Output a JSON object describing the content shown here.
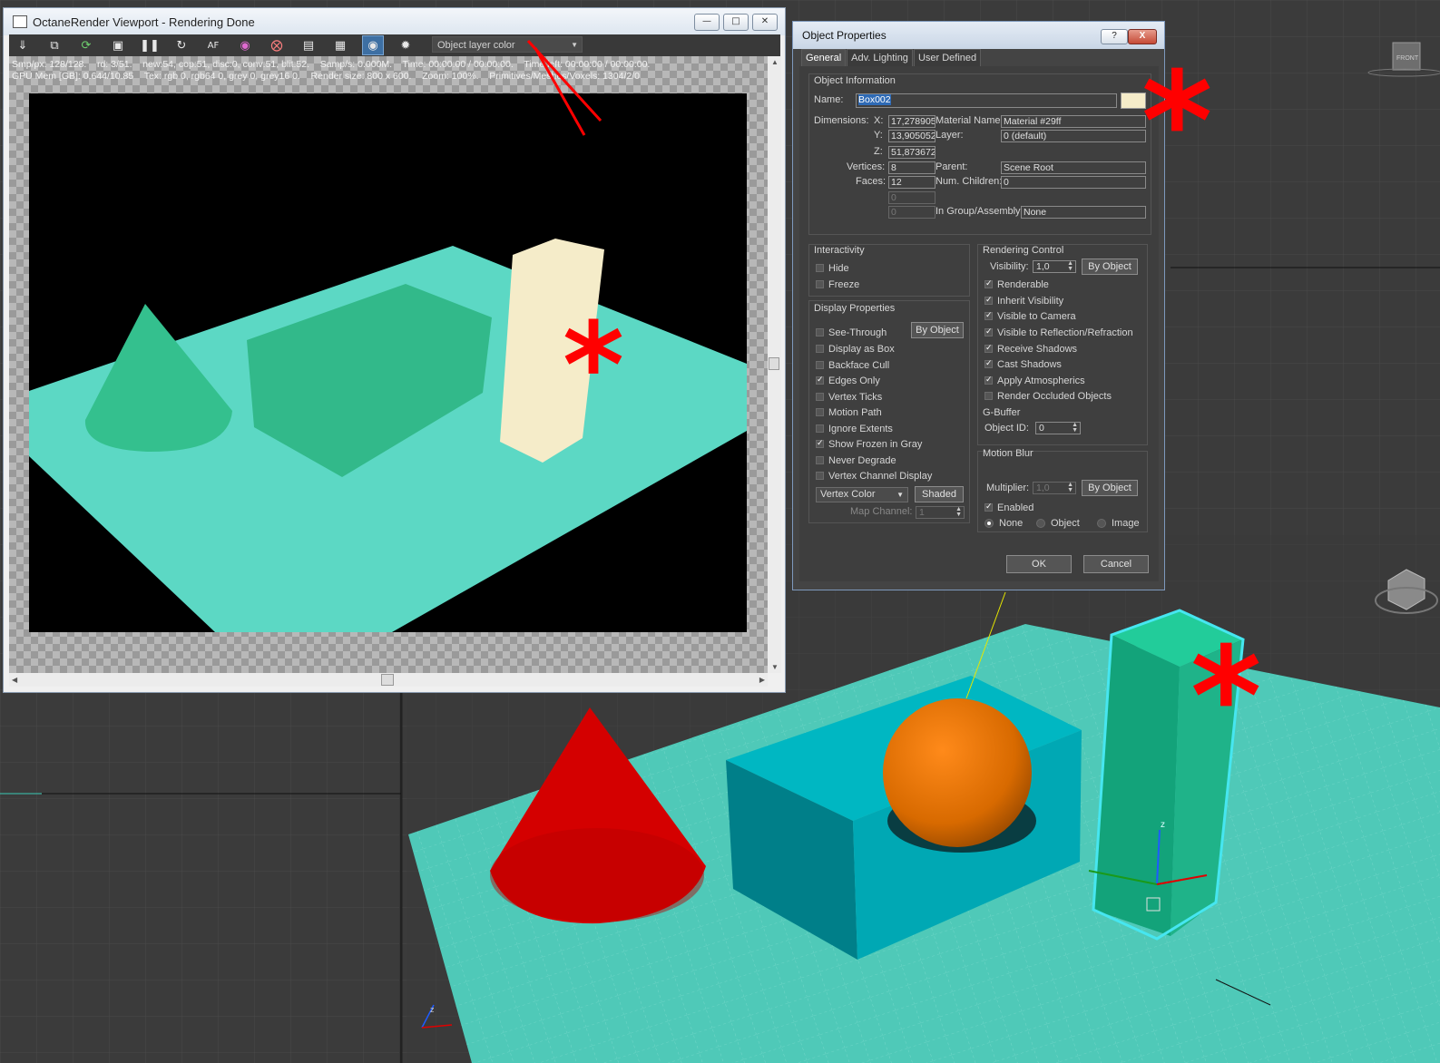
{
  "colors": {
    "selection_outline": "#46e6f0",
    "octane_plane": "#5cd8c4",
    "octane_cone": "#34c08e",
    "octane_box": "#32b98a",
    "octane_tall_box": "#f5ecc9",
    "viewport_plane": "#4fc9b8",
    "viewport_cone": "#d40000",
    "viewport_box": "#00a8b4",
    "viewport_sphere": "#e07000",
    "viewport_tall_box": "#1fb389",
    "annotation_red": "#ff0000"
  },
  "octane": {
    "title": "OctaneRender Viewport - Rendering Done",
    "layer_select": "Object layer color",
    "stats_line1": "Smp/px: 128/128.    rd: 3/51.    new:54, cop:51, disc:0, conv:51, blit:52.    Samp/s: 0.000M.    Time: 00:00:00 / 00:00:00.    Time left: 00:00:00 / 00:00:00.",
    "stats_line2": "GPU Mem [GB]: 0.644/10.85    Tex: rgb 0, rgb64 0, grey 0, grey16 0.    Render size: 800 x 600.    Zoom: 100%.    Primitives/Meshes/Voxels: 1304/2/0",
    "toolbar_icons": [
      "save-render-icon",
      "copy-icon",
      "refresh-icon",
      "lock-icon",
      "pause-icon",
      "restart-icon",
      "af-icon",
      "color-picker-icon",
      "region-icon",
      "display-icon",
      "film-icon",
      "camera-icon",
      "settings-icon"
    ]
  },
  "dialog": {
    "title": "Object Properties",
    "help": "?",
    "close": "X",
    "tabs": [
      "General",
      "Adv. Lighting",
      "User Defined"
    ],
    "info": {
      "header": "Object Information",
      "name_label": "Name:",
      "name_value": "Box002",
      "dimensions_label": "Dimensions:",
      "x_label": "X:",
      "x_value": "17,278905",
      "y_label": "Y:",
      "y_value": "13,905052",
      "z_label": "Z:",
      "z_value": "51,873672",
      "material_label": "Material Name:",
      "material_value": "Material #29ff",
      "layer_label": "Layer:",
      "layer_value": "0 (default)",
      "vertices_label": "Vertices:",
      "vertices_value": "8",
      "faces_label": "Faces:",
      "faces_value": "12",
      "blank1": "0",
      "blank2": "0",
      "parent_label": "Parent:",
      "parent_value": "Scene Root",
      "children_label": "Num. Children:",
      "children_value": "0",
      "group_label": "In Group/Assembly:",
      "group_value": "None"
    },
    "interactivity": {
      "header": "Interactivity",
      "items": [
        {
          "label": "Hide",
          "checked": false
        },
        {
          "label": "Freeze",
          "checked": false
        }
      ]
    },
    "display": {
      "header": "Display Properties",
      "by_object": "By Object",
      "items": [
        {
          "label": "See-Through",
          "checked": false
        },
        {
          "label": "Display as Box",
          "checked": false
        },
        {
          "label": "Backface Cull",
          "checked": false
        },
        {
          "label": "Edges Only",
          "checked": true
        },
        {
          "label": "Vertex Ticks",
          "checked": false
        },
        {
          "label": "Motion Path",
          "checked": false
        },
        {
          "label": "Ignore Extents",
          "checked": false
        },
        {
          "label": "Show Frozen in Gray",
          "checked": true
        },
        {
          "label": "Never Degrade",
          "checked": false
        },
        {
          "label": "Vertex Channel Display",
          "checked": false
        }
      ],
      "vertex_color": "Vertex Color",
      "shaded": "Shaded",
      "map_channel_label": "Map Channel:",
      "map_channel_value": "1"
    },
    "rendering": {
      "header": "Rendering Control",
      "visibility_label": "Visibility:",
      "visibility_value": "1,0",
      "by_object": "By Object",
      "items": [
        {
          "label": "Renderable",
          "checked": true
        },
        {
          "label": "Inherit Visibility",
          "checked": true
        },
        {
          "label": "Visible to Camera",
          "checked": true
        },
        {
          "label": "Visible to Reflection/Refraction",
          "checked": true
        },
        {
          "label": "Receive Shadows",
          "checked": true
        },
        {
          "label": "Cast Shadows",
          "checked": true
        },
        {
          "label": "Apply Atmospherics",
          "checked": true
        },
        {
          "label": "Render Occluded Objects",
          "checked": false
        }
      ],
      "gbuffer_header": "G-Buffer",
      "object_id_label": "Object ID:",
      "object_id_value": "0"
    },
    "motion_blur": {
      "header": "Motion Blur",
      "multiplier_label": "Multiplier:",
      "multiplier_value": "1,0",
      "by_object": "By Object",
      "enabled": "Enabled",
      "options": [
        {
          "label": "None",
          "checked": true
        },
        {
          "label": "Object",
          "checked": false
        },
        {
          "label": "Image",
          "checked": false
        }
      ]
    },
    "ok": "OK",
    "cancel": "Cancel"
  },
  "viewport": {
    "viewcube_label": "FRONT",
    "gizmo_z": "z",
    "gizmo_x": "x"
  }
}
